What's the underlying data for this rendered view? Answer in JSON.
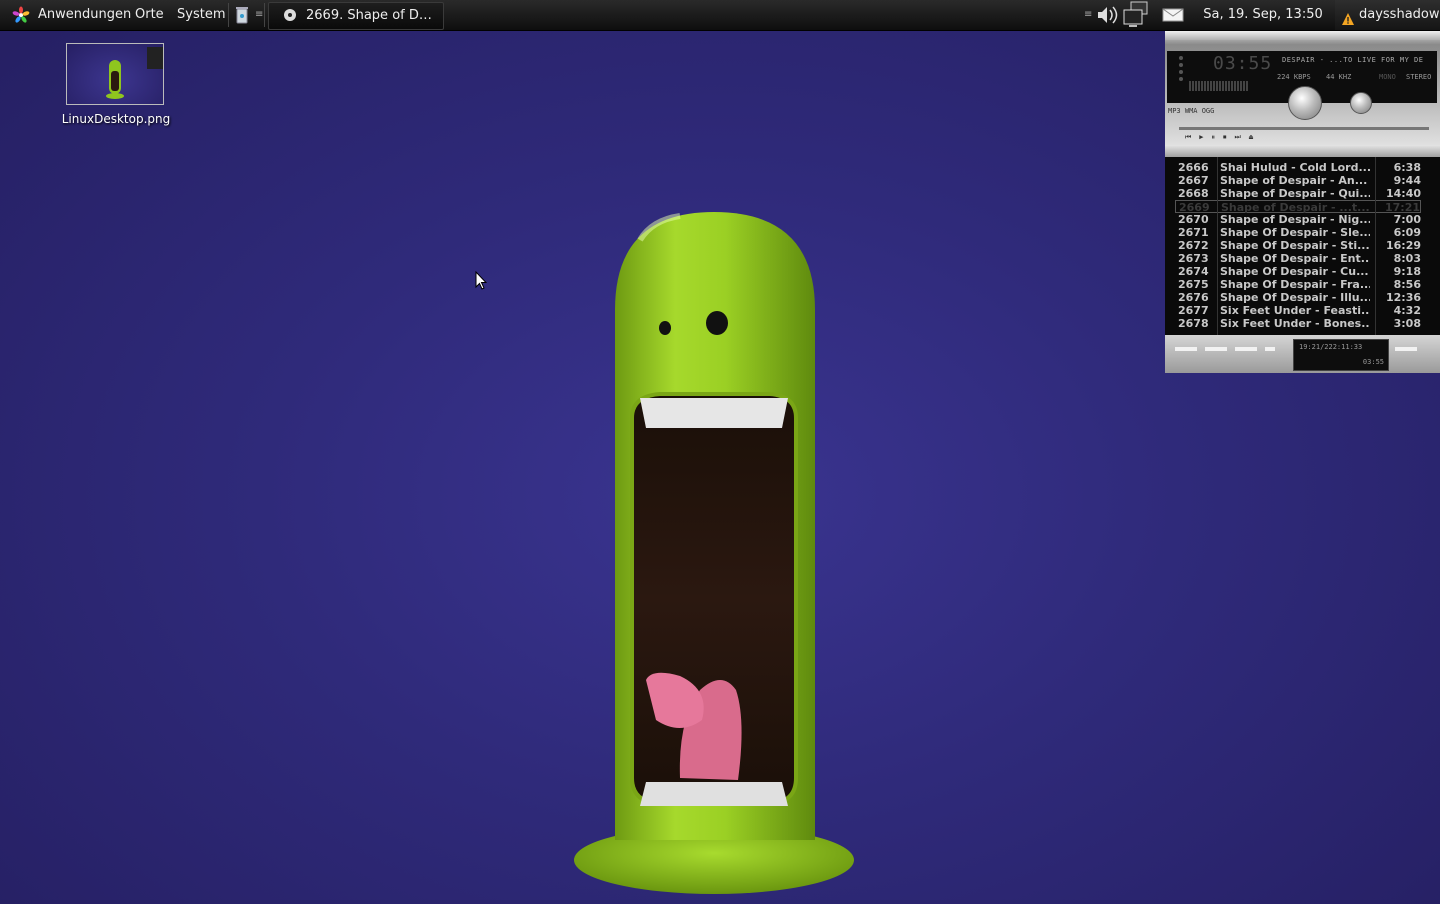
{
  "panel": {
    "menu_apps": "Anwendungen",
    "menu_places": "Orte",
    "menu_system": "System",
    "task_title": "2669. Shape of D…",
    "clock": "Sa, 19. Sep, 13:50",
    "user": "daysshadow",
    "icons": [
      "gnome-foot-icon",
      "trash-icon",
      "volume-icon",
      "network-icon",
      "mail-icon",
      "warning-icon"
    ]
  },
  "desktop": {
    "icon_label": "LinuxDesktop.png"
  },
  "player": {
    "time": "03:55",
    "track": "DESPAIR - ...TO LIVE FOR MY DE",
    "kbps": "224 KBPS",
    "khz": "44 KHZ",
    "mono": "MONO",
    "stereo": "STEREO",
    "formats": "MP3 WMA OGG",
    "footer_info": "19:21/222:11:33",
    "footer_time": "03:55",
    "playlist": [
      {
        "num": "2666",
        "title": "Shai Hulud - Cold Lord...",
        "dur": "6:38"
      },
      {
        "num": "2667",
        "title": "Shape of Despair - An...",
        "dur": "9:44"
      },
      {
        "num": "2668",
        "title": "Shape of Despair - Qui...",
        "dur": "14:40"
      },
      {
        "num": "2669",
        "title": "Shape of Despair - ...t...",
        "dur": "17:21"
      },
      {
        "num": "2670",
        "title": "Shape of Despair - Nig...",
        "dur": "7:00"
      },
      {
        "num": "2671",
        "title": "Shape Of Despair - Sle...",
        "dur": "6:09"
      },
      {
        "num": "2672",
        "title": "Shape Of Despair - Sti...",
        "dur": "16:29"
      },
      {
        "num": "2673",
        "title": "Shape Of Despair - Ent...",
        "dur": "8:03"
      },
      {
        "num": "2674",
        "title": "Shape Of Despair - Cu...",
        "dur": "9:18"
      },
      {
        "num": "2675",
        "title": "Shape Of Despair - Fra...",
        "dur": "8:56"
      },
      {
        "num": "2676",
        "title": "Shape Of Despair - Illu...",
        "dur": "12:36"
      },
      {
        "num": "2677",
        "title": "Six Feet Under - Feasti...",
        "dur": "4:32"
      },
      {
        "num": "2678",
        "title": "Six Feet Under - Bones...",
        "dur": "3:08"
      }
    ],
    "current_index": 3
  },
  "colors": {
    "desktop_bg": "#2f2a7a",
    "blob_green": "#8fc61e",
    "panel_bg": "#111111"
  }
}
